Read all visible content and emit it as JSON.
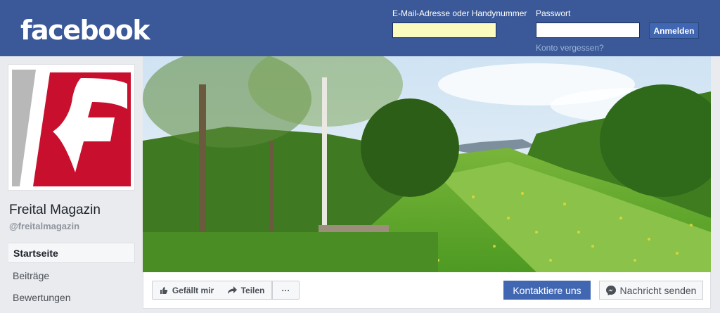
{
  "header": {
    "logo": "facebook",
    "email_label": "E-Mail-Adresse oder Handynummer",
    "password_label": "Passwort",
    "email_value": "",
    "password_value": "",
    "login_button": "Anmelden",
    "forgot_link": "Konto vergessen?"
  },
  "page": {
    "name": "Freital Magazin",
    "handle": "@freitalmagazin",
    "logo_icon": "freital-magazin-logo"
  },
  "sidebar": {
    "items": [
      {
        "label": "Startseite",
        "active": true
      },
      {
        "label": "Beiträge",
        "active": false
      },
      {
        "label": "Bewertungen",
        "active": false
      }
    ]
  },
  "actions": {
    "like": "Gefällt mir",
    "share": "Teilen",
    "more": "···",
    "contact": "Kontaktiere uns",
    "message": "Nachricht senden"
  },
  "colors": {
    "brand": "#3b5998",
    "primary_button": "#4267b2",
    "logo_red": "#c8102e"
  }
}
